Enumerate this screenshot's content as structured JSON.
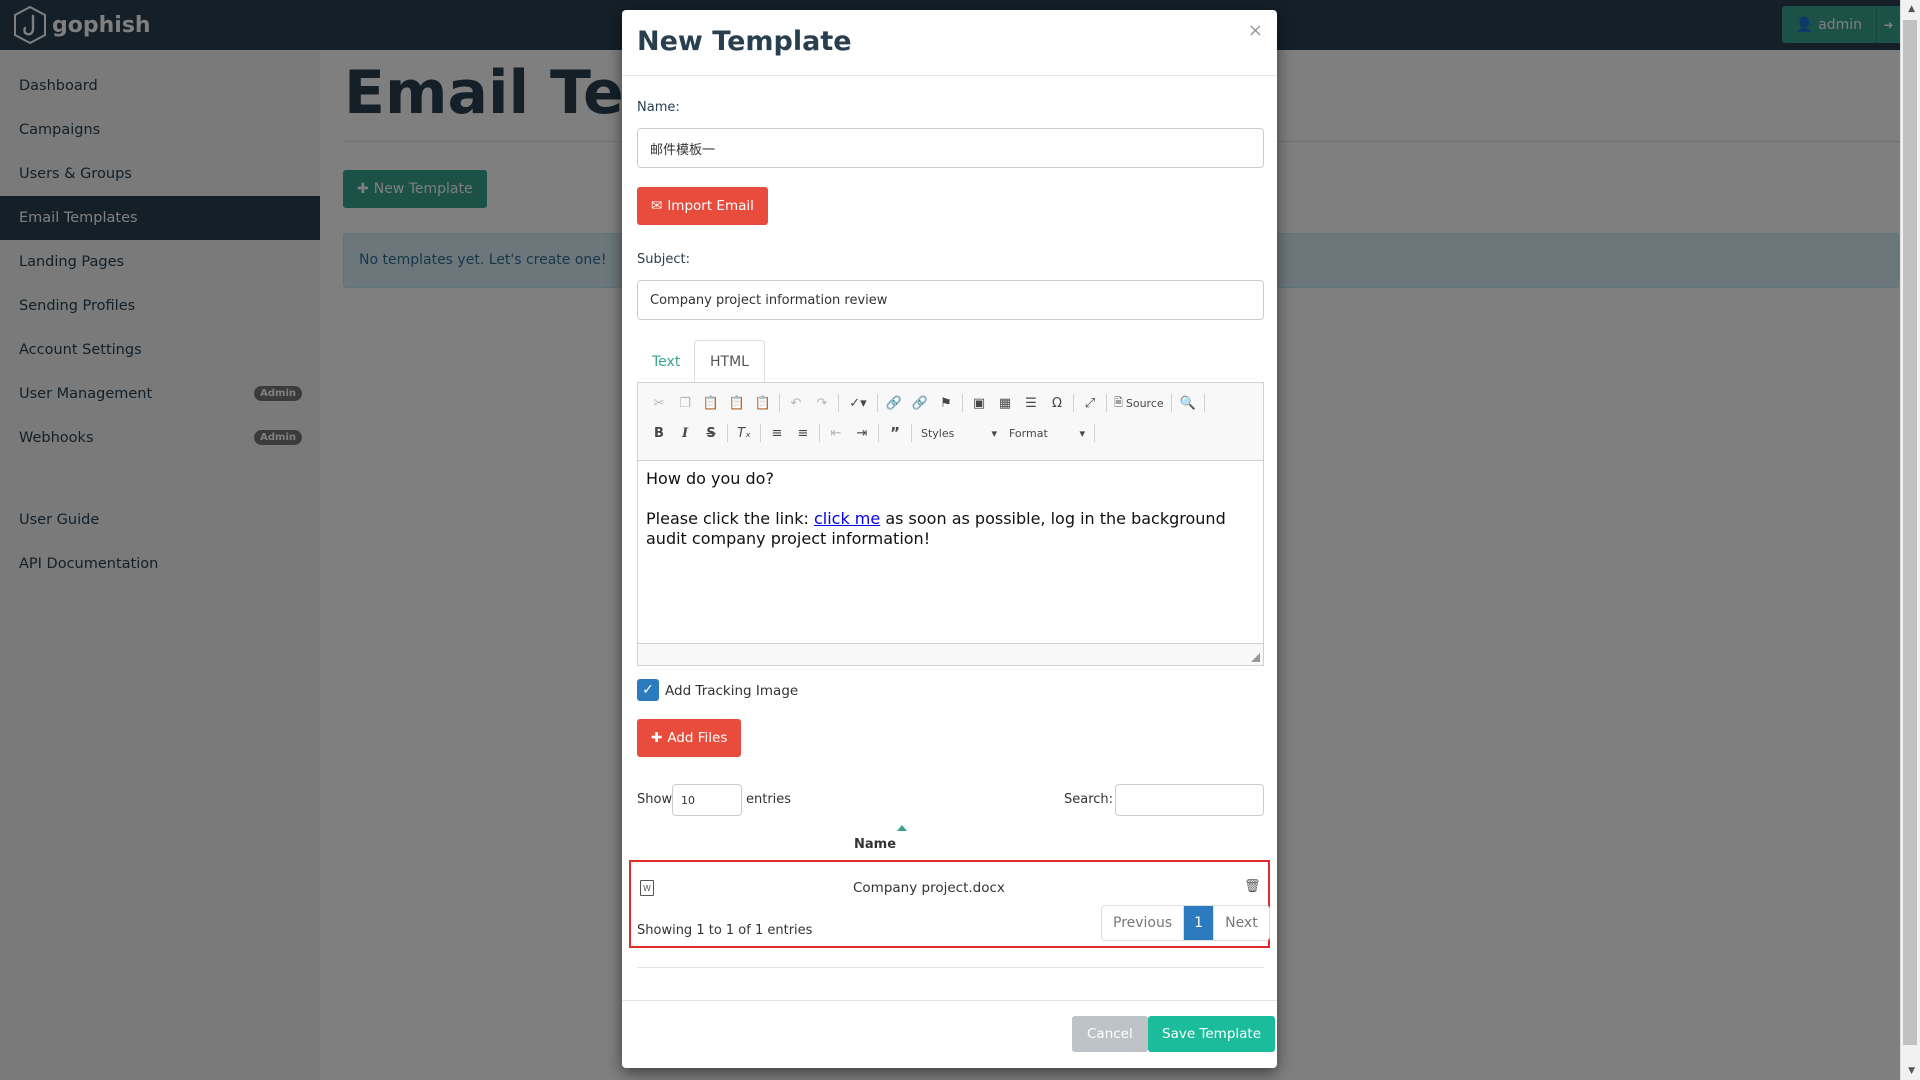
{
  "app": {
    "brand": "gophish"
  },
  "navbar": {
    "user_label": "admin",
    "user_icon": "user-icon",
    "logout_icon": "sign-out-icon"
  },
  "sidebar": {
    "items": [
      {
        "label": "Dashboard"
      },
      {
        "label": "Campaigns"
      },
      {
        "label": "Users & Groups"
      },
      {
        "label": "Email Templates",
        "active": true
      },
      {
        "label": "Landing Pages"
      },
      {
        "label": "Sending Profiles"
      },
      {
        "label": "Account Settings"
      },
      {
        "label": "User Management",
        "badge": "Admin"
      },
      {
        "label": "Webhooks",
        "badge": "Admin"
      }
    ],
    "secondary": [
      {
        "label": "User Guide"
      },
      {
        "label": "API Documentation"
      }
    ]
  },
  "main": {
    "title": "Email Templates",
    "new_template_label": "New Template",
    "empty_message": "No templates yet. Let's create one!"
  },
  "modal": {
    "title": "New Template",
    "close_symbol": "×",
    "name_label": "Name:",
    "name_value": "邮件模板一",
    "import_email_label": "Import Email",
    "subject_label": "Subject:",
    "subject_value": "Company project information review",
    "tabs": [
      {
        "label": "Text"
      },
      {
        "label": "HTML",
        "active": true
      }
    ],
    "editor": {
      "source_label": "Source",
      "styles_label": "Styles",
      "format_label": "Format",
      "line1": "How do you do?",
      "line2_before": "Please click the link: ",
      "link_text": "click me",
      "line2_after": " as soon as possible, log in the background audit company project information!"
    },
    "tracking_label": "Add Tracking Image",
    "tracking_checked": true,
    "add_files_label": "Add Files",
    "attachments": {
      "show_label": "Show",
      "entries_value": "10",
      "entries_label": "entries",
      "search_label": "Search:",
      "search_value": "",
      "column_name": "Name",
      "rows": [
        {
          "name": "Company project.docx",
          "icon": "word-file-icon"
        }
      ],
      "info": "Showing 1 to 1 of 1 entries",
      "previous_label": "Previous",
      "current_page": "1",
      "next_label": "Next"
    },
    "cancel_label": "Cancel",
    "save_label": "Save Template"
  },
  "colors": {
    "navbar": "#283f50",
    "accent": "#37a38f",
    "danger": "#e74c3c",
    "primary": "#2c7bbf",
    "save": "#1abc9c",
    "highlight_border": "#e32b2b"
  }
}
